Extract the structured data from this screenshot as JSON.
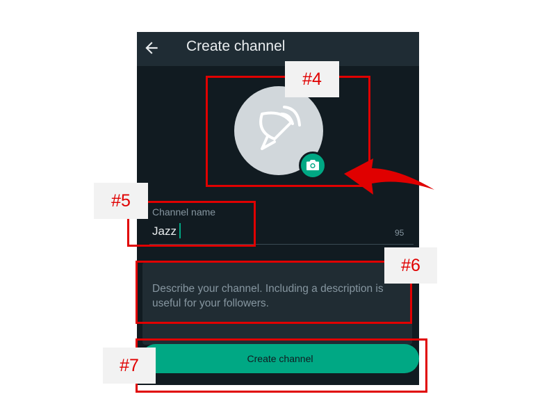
{
  "header": {
    "back_icon": "arrow-left-icon",
    "title": "Create channel"
  },
  "avatar": {
    "placeholder_icon": "channel-broadcast-icon",
    "camera_icon": "camera-icon"
  },
  "channel_name": {
    "label": "Channel name",
    "value": "Jazz",
    "remaining_chars": "95"
  },
  "description": {
    "placeholder": "Describe your channel. Including a description is useful for your followers."
  },
  "create_button": {
    "label": "Create channel"
  },
  "annotations": [
    {
      "label": "#4"
    },
    {
      "label": "#5"
    },
    {
      "label": "#6"
    },
    {
      "label": "#7"
    }
  ],
  "colors": {
    "background": "#111b21",
    "header": "#1f2c34",
    "accent": "#00a884",
    "annotation": "#e00000"
  }
}
